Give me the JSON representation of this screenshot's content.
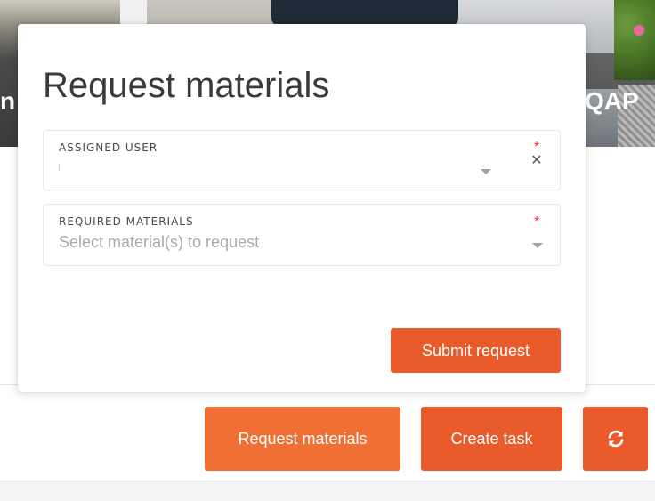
{
  "hero": {
    "left_text": "n",
    "right_text": "QAP"
  },
  "modal": {
    "title": "Request materials",
    "fields": {
      "assigned_user": {
        "label": "ASSIGNED USER",
        "value": "",
        "required_mark": "*",
        "clear_icon": "x-icon",
        "arrow_icon": "caret-down-icon"
      },
      "required_materials": {
        "label": "REQUIRED MATERIALS",
        "placeholder": "Select material(s) to request",
        "value": "",
        "required_mark": "*",
        "arrow_icon": "caret-down-icon"
      }
    },
    "submit_label": "Submit request"
  },
  "actions": {
    "request_materials_label": "Request materials",
    "create_task_label": "Create task",
    "refresh_icon": "refresh-icon"
  },
  "colors": {
    "primary": "#e95b2a",
    "primary_light": "#f06f35",
    "required": "#e53935"
  }
}
